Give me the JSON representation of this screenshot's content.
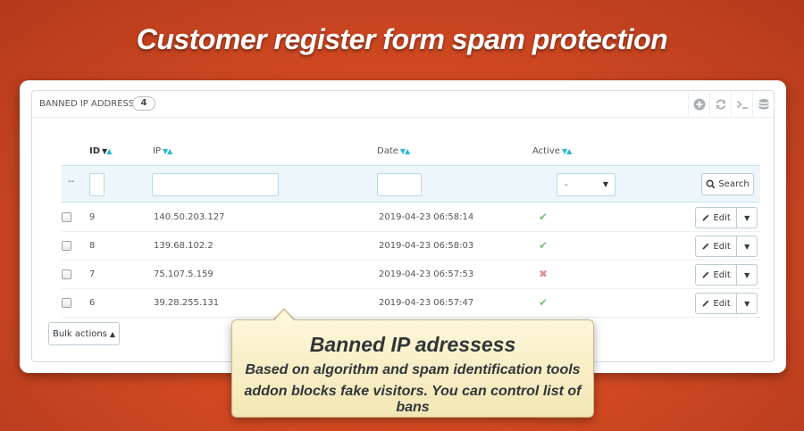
{
  "headline": "Customer register form spam protection",
  "panel": {
    "title": "BANNED IP ADDRESSES",
    "count": "4",
    "tools": [
      "add-icon",
      "refresh-icon",
      "terminal-icon",
      "database-icon"
    ]
  },
  "table": {
    "columns": {
      "id": "ID",
      "ip": "IP",
      "date": "Date",
      "active": "Active"
    },
    "filter": {
      "dash": "--",
      "active_value": "-",
      "search_label": "Search"
    },
    "rows": [
      {
        "id": "9",
        "ip": "140.50.203.127",
        "date": "2019-04-23 06:58:14",
        "active": true
      },
      {
        "id": "8",
        "ip": "139.68.102.2",
        "date": "2019-04-23 06:58:03",
        "active": true
      },
      {
        "id": "7",
        "ip": "75.107.5.159",
        "date": "2019-04-23 06:57:53",
        "active": false
      },
      {
        "id": "6",
        "ip": "39.28.255.131",
        "date": "2019-04-23 06:57:47",
        "active": true
      }
    ],
    "edit_label": "Edit",
    "bulk_label": "Bulk actions"
  },
  "tooltip": {
    "title": "Banned IP adressess",
    "line1": "Based on algorithm and spam identification tools",
    "line2": "addon blocks fake visitors. You can control list of bans"
  },
  "colors": {
    "background": "#d44a22",
    "accent": "#25b9d7",
    "ok": "#72c279",
    "no": "#e08f95"
  }
}
